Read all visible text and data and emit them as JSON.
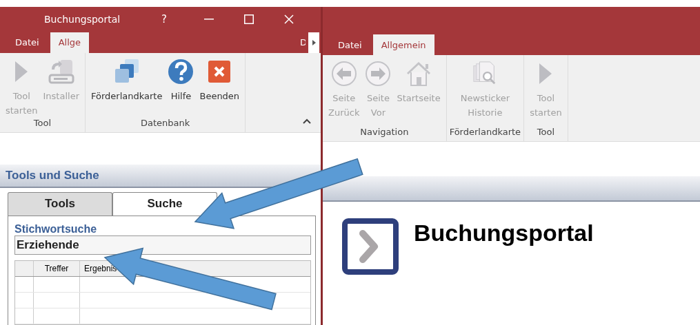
{
  "left_window": {
    "title": "Buchungsportal",
    "help": "?",
    "tabs": [
      {
        "label": "Datei",
        "selected": false
      },
      {
        "label": "Allge",
        "selected": true
      },
      {
        "label": "D",
        "selected": false
      }
    ],
    "groups": [
      {
        "label": "Tool",
        "buttons": [
          {
            "label": "Tool starten",
            "disabled": true
          },
          {
            "label": "Installer",
            "disabled": true
          }
        ]
      },
      {
        "label": "Datenbank",
        "buttons": [
          {
            "label": "Förderlandkarte",
            "disabled": false
          },
          {
            "label": "Hilfe",
            "disabled": false
          },
          {
            "label": "Beenden",
            "disabled": false
          }
        ]
      }
    ],
    "panel": {
      "title": "Tools und Suche",
      "tabs": [
        {
          "label": "Tools",
          "selected": false
        },
        {
          "label": "Suche",
          "selected": true
        }
      ],
      "search_label": "Stichwortsuche",
      "search_value": "Erziehende",
      "table": {
        "columns": [
          "Treffer",
          "Ergebnis"
        ]
      }
    }
  },
  "right_window": {
    "tabs": [
      {
        "label": "Datei",
        "selected": false
      },
      {
        "label": "Allgemein",
        "selected": true
      }
    ],
    "groups": [
      {
        "label": "Navigation",
        "buttons": [
          {
            "label": "Seite Zurück",
            "disabled": true
          },
          {
            "label": "Seite Vor",
            "disabled": true
          },
          {
            "label": "Startseite",
            "disabled": true
          }
        ]
      },
      {
        "label": "Förderlandkarte",
        "buttons": [
          {
            "label": "Newsticker Historie",
            "disabled": true
          }
        ]
      },
      {
        "label": "Tool",
        "buttons": [
          {
            "label": "Tool starten",
            "disabled": true
          }
        ]
      }
    ],
    "content": {
      "heading": "Buchungsportal"
    }
  }
}
